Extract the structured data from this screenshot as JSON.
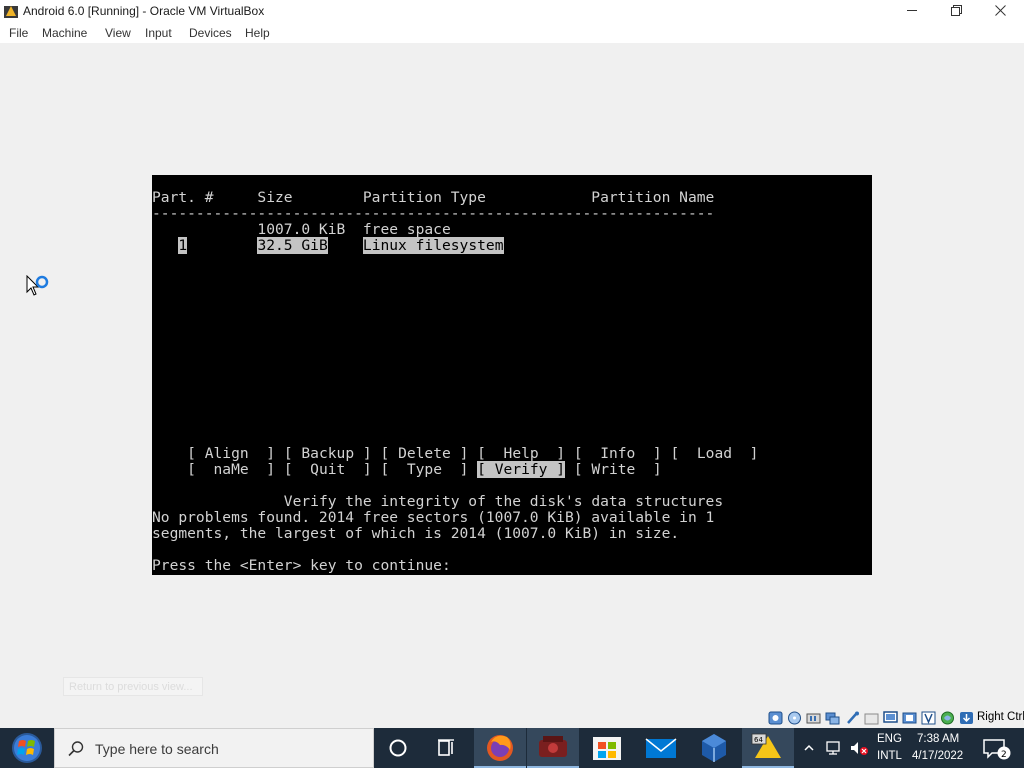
{
  "window": {
    "title": "Android 6.0 [Running] - Oracle VM VirtualBox",
    "controls": {
      "minimize": "minimize-icon",
      "maximize": "maximize-icon",
      "close": "close-icon"
    }
  },
  "menubar": {
    "items": [
      "File",
      "Machine",
      "View",
      "Input",
      "Devices",
      "Help"
    ]
  },
  "console": {
    "header": "Part. #     Size        Partition Type            Partition Name",
    "separator": "----------------------------------------------------------------",
    "free_row": "            1007.0 KiB  free space",
    "partition": {
      "number": "1",
      "size": "32.5 GiB",
      "type": "Linux filesystem"
    },
    "buttons": [
      [
        "[ Align  ]",
        "[ Backup ]",
        "[ Delete ]",
        "[  Help  ]",
        "[  Info  ]",
        "[  Load  ]"
      ],
      [
        "[  naMe  ]",
        "[  Quit  ]",
        "[  Type  ]",
        "[ Verify ]",
        "[ Write  ]"
      ]
    ],
    "selected_button": "[ Verify ]",
    "description": "Verify the integrity of the disk's data structures",
    "message_line1": "No problems found. 2014 free sectors (1007.0 KiB) available in 1",
    "message_line2": "segments, the largest of which is 2014 (1007.0 KiB) in size.",
    "prompt": "Press the <Enter> key to continue:"
  },
  "overlay": {
    "tooltip": "Return to previous view..."
  },
  "statusbar": {
    "icons": [
      "hard-disk-icon",
      "optical-drive-icon",
      "audio-icon",
      "network-icon",
      "usb-icon",
      "shared-folders-icon",
      "display-icon",
      "recording-icon",
      "vrde-icon",
      "cpu-icon",
      "mouse-integration-icon",
      "host-key-icon"
    ],
    "host_key": "Right Ctrl"
  },
  "taskbar": {
    "search_placeholder": "Type here to search",
    "apps": [
      "cortana-icon",
      "task-view-icon",
      "firefox-icon",
      "photos-app-icon",
      "microsoft-store-icon",
      "mail-icon",
      "virtualbox-icon",
      "virtualbox-vm-icon"
    ],
    "tray": {
      "language_line1": "ENG",
      "language_line2": "INTL",
      "time": "7:38 AM",
      "date": "4/17/2022"
    }
  },
  "colors": {
    "console_bg": "#000000",
    "console_text": "#d2d2d2",
    "highlight": "#c4c4c4",
    "taskbar": "#1d2b3a"
  }
}
